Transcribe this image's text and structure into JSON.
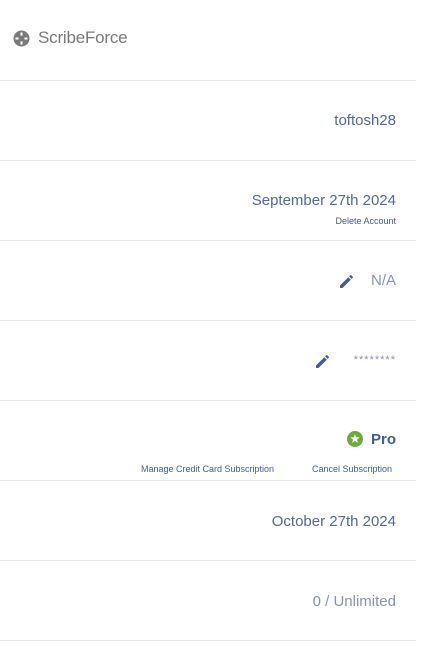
{
  "app": {
    "brand_name": "ScribeForce",
    "brand_icon": "crosshair-circle-icon"
  },
  "account": {
    "username": "toftosh28",
    "created_date": "September 27th 2024",
    "delete_account_label": "Delete Account",
    "phone_value": "N/A",
    "password_mask": "********",
    "plan_name": "Pro",
    "plan_icon": "star-badge-icon",
    "manage_subscription_label": "Manage Credit Card Subscription",
    "cancel_subscription_label": "Cancel Subscription",
    "renewal_date": "October 27th 2024",
    "usage": "0 / Unlimited"
  },
  "colors": {
    "accent": "#3f5d9a",
    "text_blue": "#4f6aa3",
    "muted": "#8a93ad",
    "brand_gray": "#7a7a7a",
    "divider": "#e6e6e6",
    "pro_green": "#6cab3a"
  }
}
